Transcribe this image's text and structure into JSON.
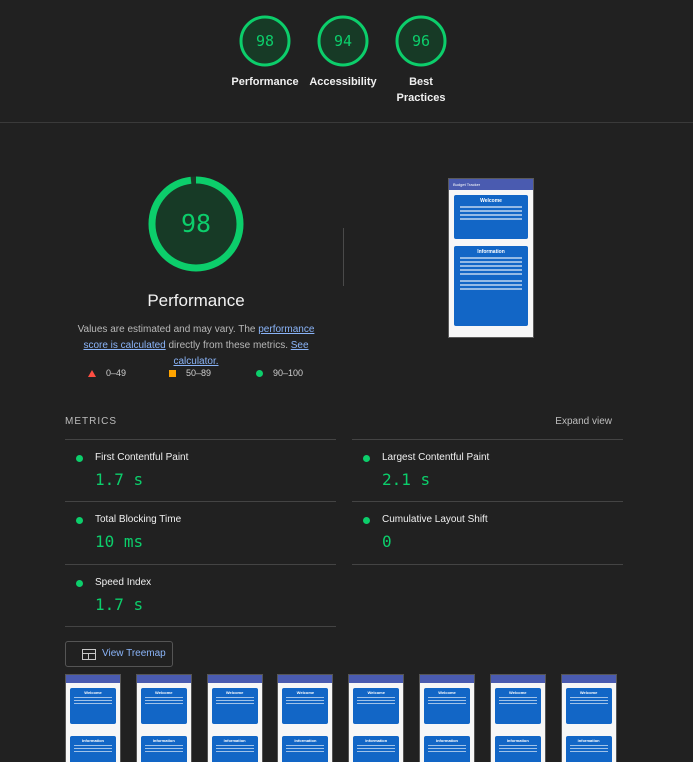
{
  "top_gauges": [
    {
      "score": "98",
      "label": "Performance"
    },
    {
      "score": "94",
      "label": "Accessibility"
    },
    {
      "score": "96",
      "label": "Best Practices"
    }
  ],
  "main": {
    "score": "98",
    "score_value": 98,
    "title": "Performance",
    "desc_prefix": "Values are estimated and may vary. The ",
    "desc_link1": "performance score is calculated",
    "desc_mid": " directly from these metrics. ",
    "desc_link2": "See calculator.",
    "legend": {
      "fail": "0–49",
      "average": "50–89",
      "pass": "90–100"
    }
  },
  "final_screenshot": {
    "app_name": "Budget Tracker",
    "card1_title": "Welcome",
    "card2_title": "Information"
  },
  "metrics": {
    "header": "METRICS",
    "expand_label": "Expand view",
    "items": [
      {
        "name": "First Contentful Paint",
        "value": "1.7 s"
      },
      {
        "name": "Largest Contentful Paint",
        "value": "2.1 s"
      },
      {
        "name": "Total Blocking Time",
        "value": "10 ms"
      },
      {
        "name": "Cumulative Layout Shift",
        "value": "0"
      },
      {
        "name": "Speed Index",
        "value": "1.7 s"
      }
    ]
  },
  "treemap_label": "View Treemap",
  "filmstrip": {
    "frame_count": 8,
    "card1_title": "Welcome",
    "card2_title": "Information"
  },
  "colors": {
    "pass": "#0cce6b",
    "average": "#ffa400",
    "fail": "#ff4e42",
    "link": "#8ab4f8",
    "background": "#212121"
  }
}
